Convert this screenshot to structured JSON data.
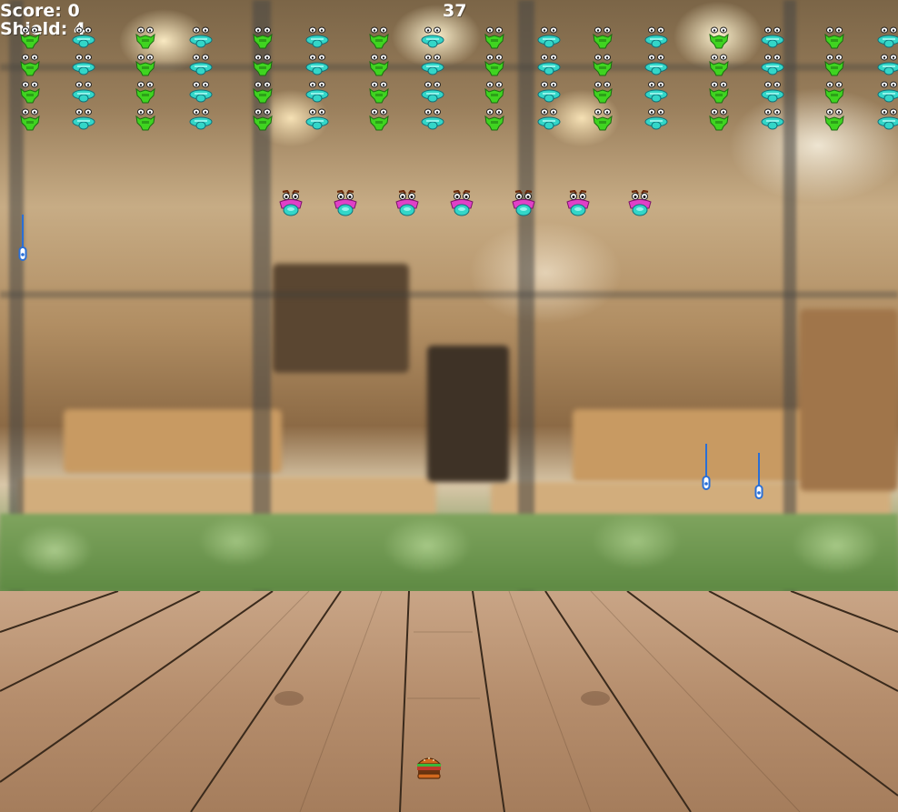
{
  "hud": {
    "score_label": "Score:",
    "score_value": "0",
    "shield_label": "Shield:",
    "shield_value": "4",
    "timer_value": "37"
  },
  "colors": {
    "hud_text": "#ffffff",
    "invader_green": "#3fd420",
    "invader_cyan": "#33d6c8",
    "invader_magenta": "#e040c8",
    "missile_blue": "#2a6fd6"
  },
  "invaders": {
    "formation": {
      "columns": 16,
      "rows": 4,
      "types_by_column": [
        "green",
        "cyan",
        "green",
        "cyan",
        "green",
        "cyan",
        "green",
        "cyan",
        "green",
        "cyan",
        "green",
        "cyan",
        "green",
        "cyan",
        "green",
        "cyan"
      ]
    },
    "squad": {
      "count": 7,
      "type": "magenta"
    }
  },
  "projectiles": {
    "count": 3,
    "icon": "missile-icon"
  },
  "player": {
    "icon": "burger-icon"
  }
}
